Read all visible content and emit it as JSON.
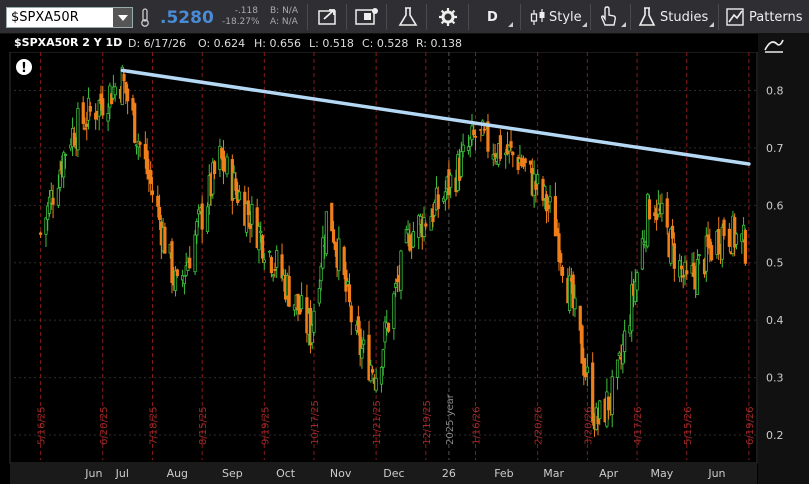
{
  "toolbar": {
    "symbol": "$SPXA50R",
    "last": ".5280",
    "net_change": "-.118",
    "pct_change": "-18.27%",
    "bid": "B: N/A",
    "ask": "A: N/A",
    "period_button": "D",
    "style_label": "Style",
    "studies_label": "Studies",
    "patterns_label": "Patterns"
  },
  "info": {
    "title": "$SPXA50R 2 Y 1D",
    "date": "D: 6/17/26",
    "open": "O: 0.624",
    "high": "H: 0.656",
    "low": "L: 0.518",
    "close": "C: 0.528",
    "range": "R: 0.138"
  },
  "chart_data": {
    "type": "candlestick",
    "ylim": [
      0.16,
      0.86
    ],
    "yticks": [
      "0.2",
      "0.3",
      "0.4",
      "0.5",
      "0.6",
      "0.7",
      "0.8"
    ],
    "month_labels": [
      "Jun",
      "Jul",
      "Aug",
      "Sep",
      "Oct",
      "Nov",
      "Dec",
      "26",
      "Feb",
      "Mar",
      "Apr",
      "May",
      "Jun"
    ],
    "date_markers": [
      "5/16/25",
      "6/20/25",
      "7/18/25",
      "8/15/25",
      "9/19/25",
      "10/17/25",
      "11/21/25",
      "12/19/25",
      "2025 year",
      "1/16/26",
      "2/20/26",
      "3/20/26",
      "4/17/26",
      "5/15/26",
      "6/19/26"
    ],
    "trendline": {
      "from": [
        "7/1/25",
        0.835
      ],
      "to": [
        "6/19/26",
        0.672
      ]
    },
    "key_points": [
      {
        "date": "5/16/25",
        "value": 0.55
      },
      {
        "date": "6/1/25",
        "value": 0.72
      },
      {
        "date": "7/1/25",
        "value": 0.82
      },
      {
        "date": "7/20/25",
        "value": 0.6
      },
      {
        "date": "8/1/25",
        "value": 0.45
      },
      {
        "date": "8/25/25",
        "value": 0.68
      },
      {
        "date": "9/15/25",
        "value": 0.56
      },
      {
        "date": "10/15/25",
        "value": 0.38
      },
      {
        "date": "10/25/25",
        "value": 0.6
      },
      {
        "date": "11/10/25",
        "value": 0.36
      },
      {
        "date": "11/21/25",
        "value": 0.31
      },
      {
        "date": "12/10/25",
        "value": 0.55
      },
      {
        "date": "12/26/25",
        "value": 0.6
      },
      {
        "date": "1/16/26",
        "value": 0.72
      },
      {
        "date": "2/10/26",
        "value": 0.68
      },
      {
        "date": "3/1/26",
        "value": 0.58
      },
      {
        "date": "3/10/26",
        "value": 0.45
      },
      {
        "date": "3/25/26",
        "value": 0.22
      },
      {
        "date": "4/5/26",
        "value": 0.28
      },
      {
        "date": "4/15/26",
        "value": 0.45
      },
      {
        "date": "4/25/26",
        "value": 0.62
      },
      {
        "date": "5/15/26",
        "value": 0.46
      },
      {
        "date": "6/5/26",
        "value": 0.56
      },
      {
        "date": "6/17/26",
        "value": 0.53
      }
    ]
  }
}
